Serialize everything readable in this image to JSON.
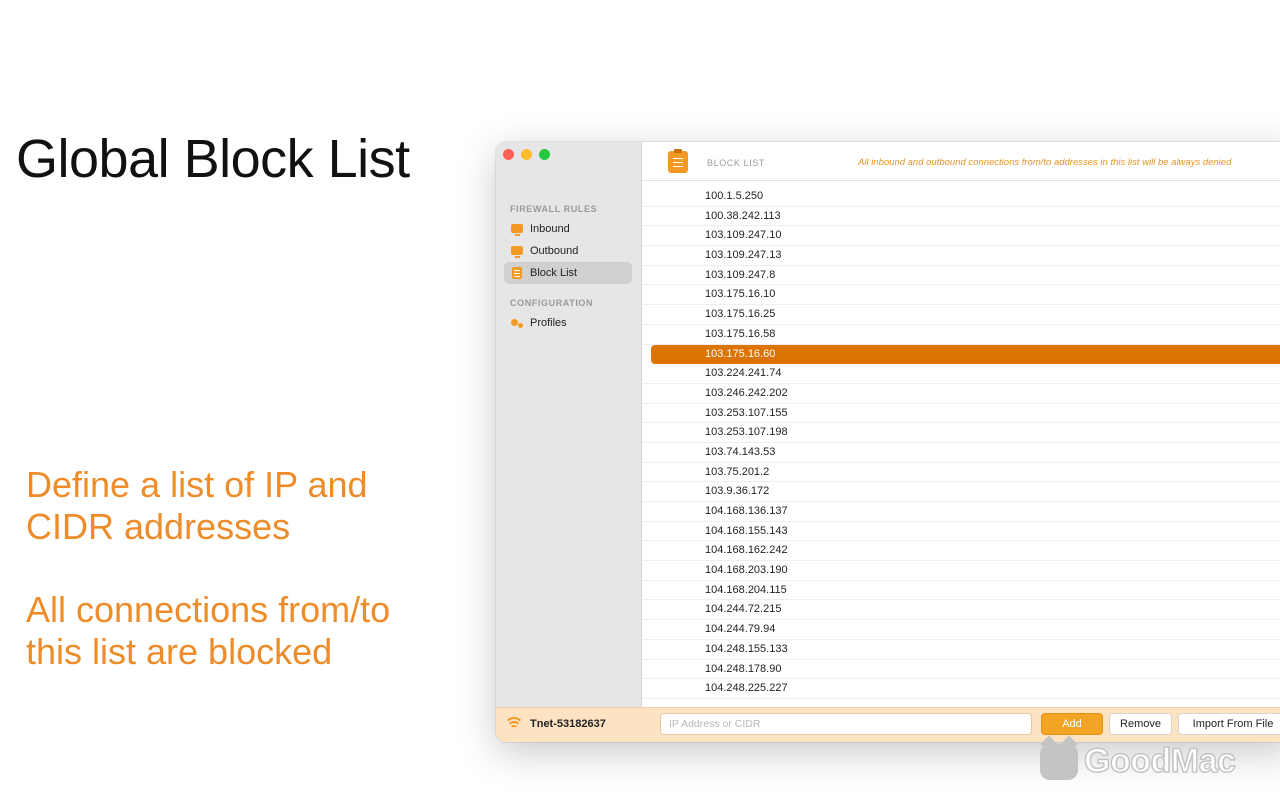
{
  "hero": {
    "title": "Global Block List",
    "desc1_line1": "Define a list of IP and",
    "desc1_line2": "CIDR addresses",
    "desc2_line1": "All connections from/to",
    "desc2_line2": "this list are blocked"
  },
  "sidebar": {
    "section1": "FIREWALL RULES",
    "inbound": "Inbound",
    "outbound": "Outbound",
    "block_list": "Block List",
    "section2": "CONFIGURATION",
    "profiles": "Profiles"
  },
  "toolbar": {
    "title": "BLOCK LIST",
    "note": "All inbound and outbound connections from/to addresses in this list will be always denied"
  },
  "ip_list": [
    "100.1.5.250",
    "100.38.242.113",
    "103.109.247.10",
    "103.109.247.13",
    "103.109.247.8",
    "103.175.16.10",
    "103.175.16.25",
    "103.175.16.58",
    "103.175.16.60",
    "103.224.241.74",
    "103.246.242.202",
    "103.253.107.155",
    "103.253.107.198",
    "103.74.143.53",
    "103.75.201.2",
    "103.9.36.172",
    "104.168.136.137",
    "104.168.155.143",
    "104.168.162.242",
    "104.168.203.190",
    "104.168.204.115",
    "104.244.72.215",
    "104.244.79.94",
    "104.248.155.133",
    "104.248.178.90",
    "104.248.225.227"
  ],
  "selected_ip": "103.175.16.60",
  "footer": {
    "network": "Tnet-53182637",
    "input_placeholder": "IP Address or CIDR",
    "add": "Add",
    "remove": "Remove",
    "import": "Import From File"
  },
  "watermark": {
    "text": "GoodMac"
  },
  "colors": {
    "accent": "#f29a24",
    "selected_row": "#dc7404",
    "hero_orange": "#ee8c2a"
  }
}
